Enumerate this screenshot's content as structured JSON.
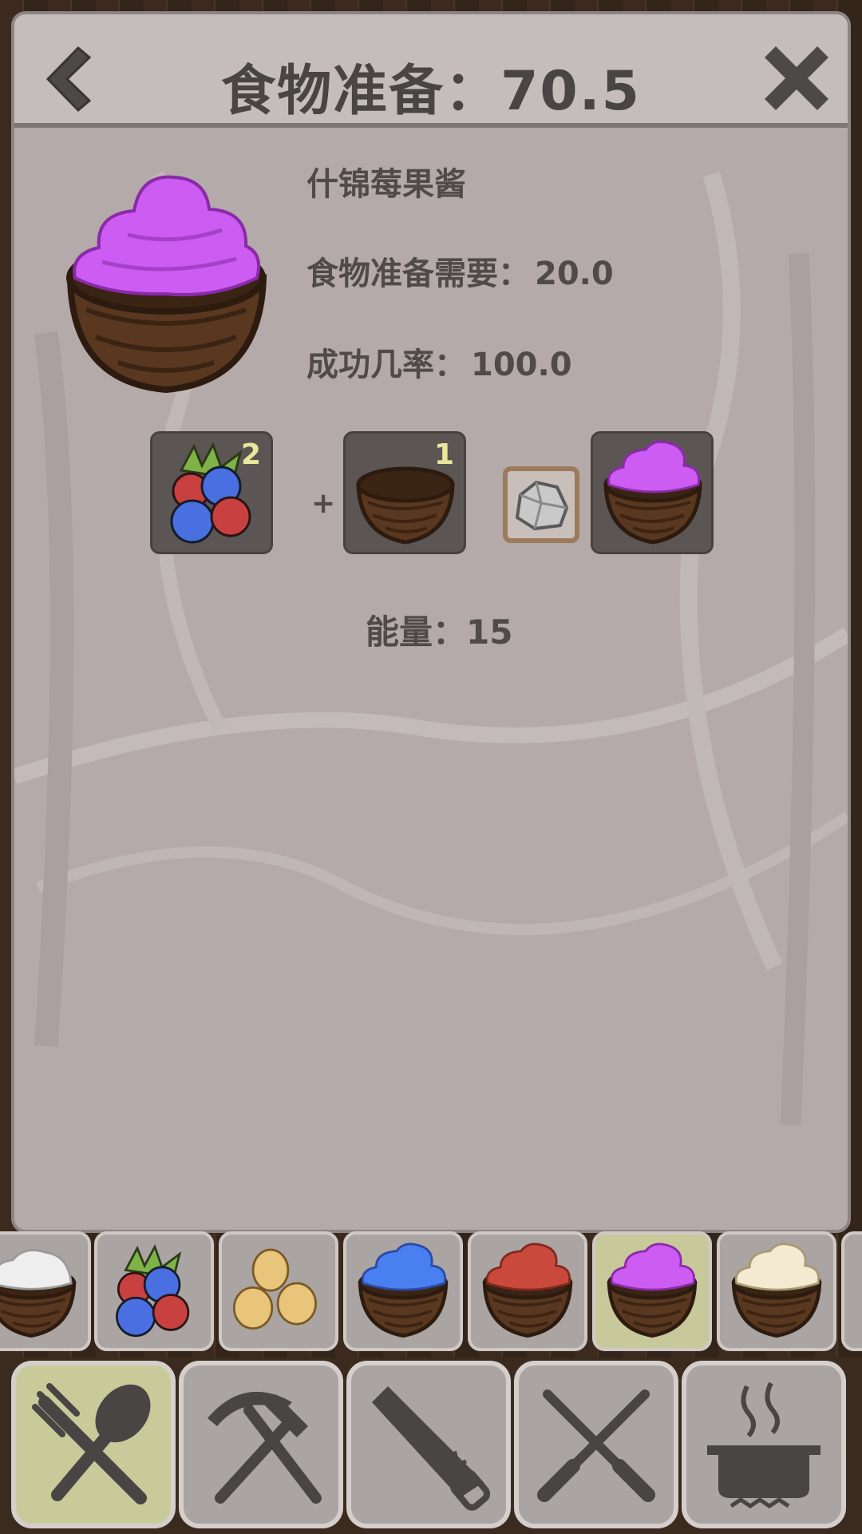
{
  "header": {
    "title": "食物准备：70.5",
    "back_icon": "chevron-left-icon",
    "close_icon": "close-icon"
  },
  "recipe": {
    "name": "什锦莓果酱",
    "requirement_label": "食物准备需要：",
    "requirement_value": "20.0",
    "success_label": "成功几率：",
    "success_value": "100.0",
    "ingredients": [
      {
        "name": "berries",
        "count": "2"
      },
      {
        "name": "coconut-shell",
        "count": "1"
      }
    ],
    "plus": "+",
    "tool": "stone",
    "result": "berry-jam",
    "energy_label": "能量：",
    "energy_value": "15"
  },
  "recipe_list": [
    {
      "name": "coconut-flakes",
      "selected": false
    },
    {
      "name": "berries",
      "selected": false
    },
    {
      "name": "nuts",
      "selected": false
    },
    {
      "name": "blue-jam",
      "selected": false
    },
    {
      "name": "red-jam",
      "selected": false
    },
    {
      "name": "berry-jam",
      "selected": true
    },
    {
      "name": "cream",
      "selected": false
    }
  ],
  "categories": [
    {
      "name": "fork-spoon-icon",
      "selected": true
    },
    {
      "name": "pickaxe-hammer-icon",
      "selected": false
    },
    {
      "name": "saw-icon",
      "selected": false
    },
    {
      "name": "knives-icon",
      "selected": false
    },
    {
      "name": "cooking-pot-icon",
      "selected": false
    }
  ],
  "colors": {
    "panel": "#b3aaa9",
    "text": "#504a4a",
    "jam_purple": "#cc5cf2",
    "jam_blue": "#4a7ff0",
    "jam_red": "#c94a3c",
    "selected": "#c8cb99"
  }
}
